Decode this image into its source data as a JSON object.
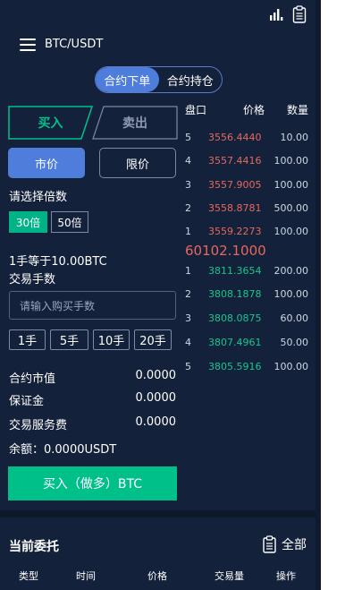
{
  "header": {
    "pair": "BTC/USDT",
    "icons": [
      "bar-chart-icon",
      "clipboard-icon",
      "menu-icon"
    ]
  },
  "contract_tabs": [
    "合约下单",
    "合约持仓"
  ],
  "trade": {
    "buy_label": "买入",
    "sell_label": "卖出",
    "market_label": "市价",
    "limit_label": "限价",
    "leverage_title": "请选择倍数",
    "leverage_options": [
      "30倍",
      "50倍"
    ],
    "lot_info": "1手等于10.00BTC",
    "qty_title": "交易手数",
    "qty_placeholder": "请输入购买手数",
    "qty_quick": [
      "1手",
      "5手",
      "10手",
      "20手"
    ],
    "contract_value_label": "合约市值",
    "contract_value": "0.0000",
    "margin_label": "保证金",
    "margin": "0.0000",
    "fee_label": "交易服务费",
    "fee": "0.0000",
    "balance": "余额：0.0000USDT",
    "submit_label": "买入（做多）BTC"
  },
  "orderbook": {
    "headers": [
      "盘口",
      "价格",
      "数量"
    ],
    "asks": [
      {
        "idx": "5",
        "price": "3556.4440",
        "qty": "10.00"
      },
      {
        "idx": "4",
        "price": "3557.4416",
        "qty": "100.00"
      },
      {
        "idx": "3",
        "price": "3557.9005",
        "qty": "100.00"
      },
      {
        "idx": "2",
        "price": "3558.8781",
        "qty": "500.00"
      },
      {
        "idx": "1",
        "price": "3559.2273",
        "qty": "100.00"
      }
    ],
    "last_price": "60102.1000",
    "bids": [
      {
        "idx": "1",
        "price": "3811.3654",
        "qty": "200.00"
      },
      {
        "idx": "2",
        "price": "3808.1878",
        "qty": "100.00"
      },
      {
        "idx": "3",
        "price": "3808.0875",
        "qty": "60.00"
      },
      {
        "idx": "4",
        "price": "3807.4961",
        "qty": "50.00"
      },
      {
        "idx": "5",
        "price": "3805.5916",
        "qty": "100.00"
      }
    ]
  },
  "orders": {
    "title": "当前委托",
    "all_label": "全部",
    "columns": [
      "类型",
      "时间",
      "价格",
      "交易量",
      "操作"
    ]
  },
  "colors": {
    "background": "#14213a",
    "accent_blue": "#4f7ddb",
    "buy_green": "#00c08a",
    "ask_red": "#e6685e",
    "bid_green": "#19c58e"
  }
}
